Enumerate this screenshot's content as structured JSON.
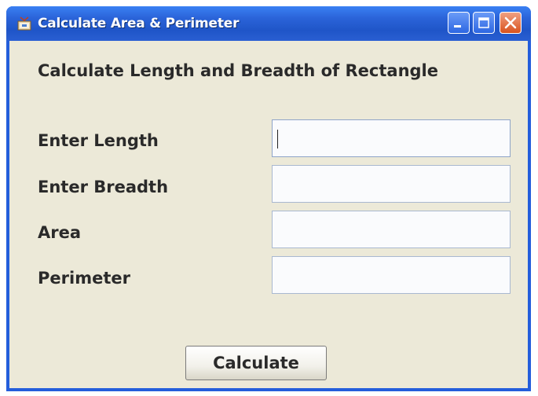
{
  "window": {
    "title": "Calculate Area & Perimeter"
  },
  "form": {
    "heading": "Calculate Length and Breadth of Rectangle",
    "fields": [
      {
        "label": "Enter Length",
        "value": ""
      },
      {
        "label": "Enter Breadth",
        "value": ""
      },
      {
        "label": "Area",
        "value": ""
      },
      {
        "label": "Perimeter",
        "value": ""
      }
    ],
    "calculate_label": "Calculate"
  },
  "icons": {
    "app": "java-app-icon",
    "minimize": "minimize-icon",
    "maximize": "maximize-icon",
    "close": "close-icon"
  },
  "colors": {
    "titlebar": "#245edb",
    "client": "#ece9d8",
    "close_button": "#d9531e"
  }
}
